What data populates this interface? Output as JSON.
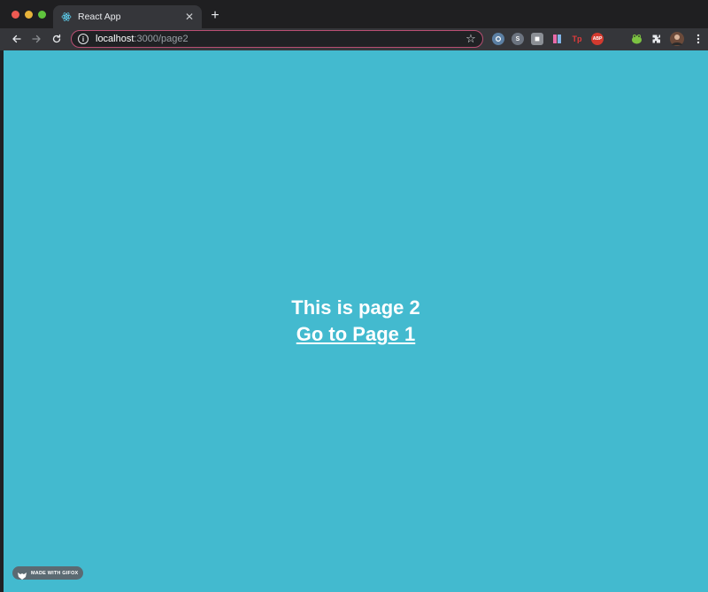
{
  "browser": {
    "tab": {
      "title": "React App",
      "close_glyph": "✕"
    },
    "new_tab_glyph": "+",
    "address": {
      "host": "localhost",
      "path": ":3000/page2"
    },
    "omnibox_border_color": "#b94f73",
    "extensions": [
      {
        "name": "extension-icon-1",
        "label": ""
      },
      {
        "name": "extension-icon-2",
        "label": "S"
      },
      {
        "name": "extension-icon-3",
        "label": ""
      },
      {
        "name": "extension-icon-4",
        "label": ""
      },
      {
        "name": "extension-icon-tp",
        "label": "Tp"
      },
      {
        "name": "extension-icon-abp",
        "label": "ABP"
      },
      {
        "name": "extension-icon-frog",
        "label": ""
      }
    ]
  },
  "page": {
    "background_color": "#43bacf",
    "heading": "This is page 2",
    "link_text": "Go to Page 1"
  },
  "badge": {
    "text": "MADE WITH GIFOX"
  }
}
